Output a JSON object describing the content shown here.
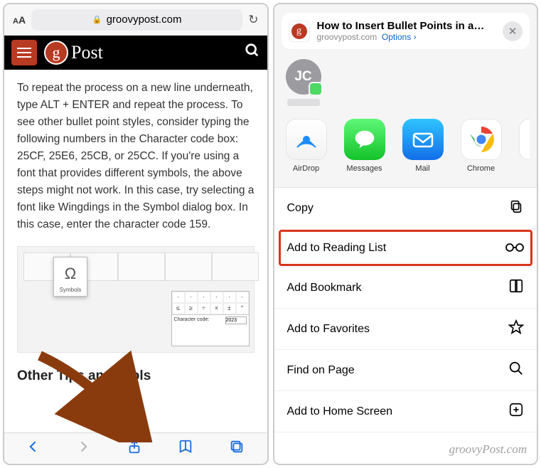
{
  "left": {
    "addressbar": {
      "aa": "AA",
      "domain": "groovypost.com"
    },
    "site": {
      "logo_letter": "g",
      "logo_text": "Post"
    },
    "article": {
      "paragraph": "To repeat the process on a new line underneath, type ALT + ENTER and repeat the process. To see other bullet point styles, consider typing the following numbers in the Character code box: 25CF, 25E6, 25CB, or 25CC. If you're using a font that provides different symbols, the above steps might not work. In this case, try selecting a font like Wingdings in the Symbol dialog box. In this case, enter the character code 159.",
      "symbol_caption": "Symbols",
      "charcode_label": "Character code:",
      "charcode_value": "2023",
      "heading": "Other Tips and Tools"
    }
  },
  "right": {
    "header": {
      "title": "How to Insert Bullet Points in a…",
      "domain": "groovypost.com",
      "options": "Options"
    },
    "contact_initials": "JC",
    "apps": [
      {
        "name": "AirDrop"
      },
      {
        "name": "Messages"
      },
      {
        "name": "Mail"
      },
      {
        "name": "Chrome"
      }
    ],
    "actions": [
      {
        "label": "Copy",
        "icon": "copy"
      },
      {
        "label": "Add to Reading List",
        "icon": "glasses",
        "highlight": true
      },
      {
        "label": "Add Bookmark",
        "icon": "book"
      },
      {
        "label": "Add to Favorites",
        "icon": "star"
      },
      {
        "label": "Find on Page",
        "icon": "search"
      },
      {
        "label": "Add to Home Screen",
        "icon": "plus-square"
      }
    ]
  },
  "watermark": "groovyPost.com"
}
